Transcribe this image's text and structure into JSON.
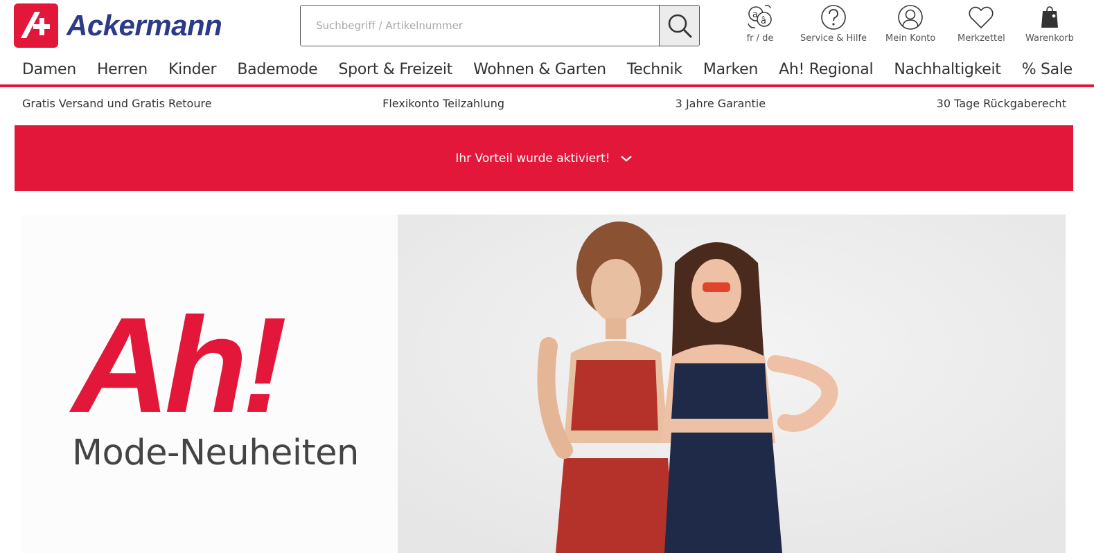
{
  "brand": {
    "name": "Ackermann",
    "color": "#2b3b87",
    "accent": "#e2173a"
  },
  "search": {
    "placeholder": "Suchbegriff / Artikelnummer",
    "button_icon": "search-icon"
  },
  "header_icons": [
    {
      "icon": "language-icon",
      "label": "fr / de"
    },
    {
      "icon": "help-icon",
      "label": "Service & Hilfe"
    },
    {
      "icon": "account-icon",
      "label": "Mein Konto"
    },
    {
      "icon": "heart-icon",
      "label": "Merkzettel"
    },
    {
      "icon": "cart-icon",
      "label": "Warenkorb"
    }
  ],
  "nav": {
    "items": [
      "Damen",
      "Herren",
      "Kinder",
      "Bademode",
      "Sport & Freizeit",
      "Wohnen & Garten",
      "Technik",
      "Marken",
      "Ah! Regional",
      "Nachhaltigkeit",
      "% Sale"
    ]
  },
  "usp": [
    "Gratis Versand und Gratis Retoure",
    "Flexikonto Teilzahlung",
    "3 Jahre Garantie",
    "30 Tage Rückgaberecht"
  ],
  "promo": {
    "text": "Ihr Vorteil wurde aktiviert!",
    "icon": "chevron-down-icon"
  },
  "hero": {
    "headline": "Ah!",
    "subline": "Mode-Neuheiten"
  }
}
